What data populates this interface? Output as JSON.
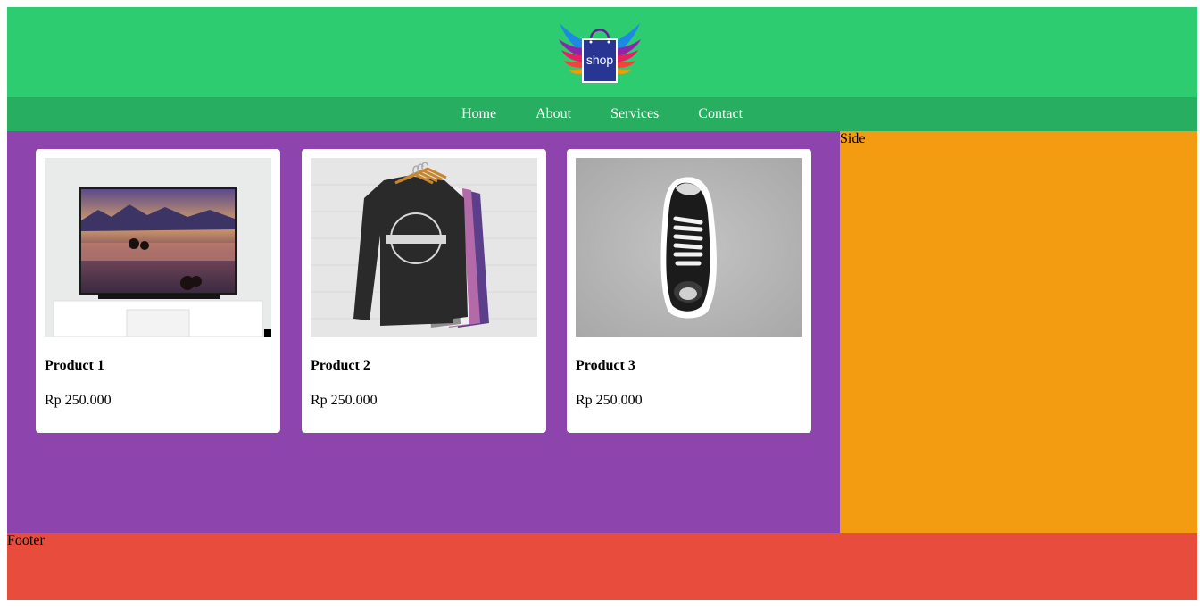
{
  "header": {
    "logo_text": "shop"
  },
  "nav": {
    "items": [
      {
        "label": "Home"
      },
      {
        "label": "About"
      },
      {
        "label": "Services"
      },
      {
        "label": "Contact"
      }
    ]
  },
  "products": [
    {
      "name": "Product 1",
      "price": "Rp 250.000",
      "image": "tv-image"
    },
    {
      "name": "Product 2",
      "price": "Rp 250.000",
      "image": "sweatshirts-image"
    },
    {
      "name": "Product 3",
      "price": "Rp 250.000",
      "image": "sneaker-image"
    }
  ],
  "side": {
    "label": "Side"
  },
  "footer": {
    "label": "Footer"
  },
  "colors": {
    "header": "#2ecc71",
    "nav": "#27ae60",
    "main": "#8e44ad",
    "side": "#f39c12",
    "footer": "#e74c3c"
  }
}
